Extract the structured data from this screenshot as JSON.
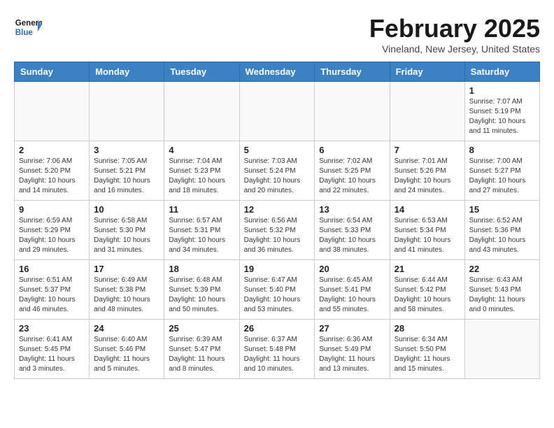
{
  "header": {
    "logo_line1": "General",
    "logo_line2": "Blue",
    "month_title": "February 2025",
    "location": "Vineland, New Jersey, United States"
  },
  "weekdays": [
    "Sunday",
    "Monday",
    "Tuesday",
    "Wednesday",
    "Thursday",
    "Friday",
    "Saturday"
  ],
  "weeks": [
    [
      {
        "day": "",
        "info": ""
      },
      {
        "day": "",
        "info": ""
      },
      {
        "day": "",
        "info": ""
      },
      {
        "day": "",
        "info": ""
      },
      {
        "day": "",
        "info": ""
      },
      {
        "day": "",
        "info": ""
      },
      {
        "day": "1",
        "info": "Sunrise: 7:07 AM\nSunset: 5:19 PM\nDaylight: 10 hours\nand 11 minutes."
      }
    ],
    [
      {
        "day": "2",
        "info": "Sunrise: 7:06 AM\nSunset: 5:20 PM\nDaylight: 10 hours\nand 14 minutes."
      },
      {
        "day": "3",
        "info": "Sunrise: 7:05 AM\nSunset: 5:21 PM\nDaylight: 10 hours\nand 16 minutes."
      },
      {
        "day": "4",
        "info": "Sunrise: 7:04 AM\nSunset: 5:23 PM\nDaylight: 10 hours\nand 18 minutes."
      },
      {
        "day": "5",
        "info": "Sunrise: 7:03 AM\nSunset: 5:24 PM\nDaylight: 10 hours\nand 20 minutes."
      },
      {
        "day": "6",
        "info": "Sunrise: 7:02 AM\nSunset: 5:25 PM\nDaylight: 10 hours\nand 22 minutes."
      },
      {
        "day": "7",
        "info": "Sunrise: 7:01 AM\nSunset: 5:26 PM\nDaylight: 10 hours\nand 24 minutes."
      },
      {
        "day": "8",
        "info": "Sunrise: 7:00 AM\nSunset: 5:27 PM\nDaylight: 10 hours\nand 27 minutes."
      }
    ],
    [
      {
        "day": "9",
        "info": "Sunrise: 6:59 AM\nSunset: 5:29 PM\nDaylight: 10 hours\nand 29 minutes."
      },
      {
        "day": "10",
        "info": "Sunrise: 6:58 AM\nSunset: 5:30 PM\nDaylight: 10 hours\nand 31 minutes."
      },
      {
        "day": "11",
        "info": "Sunrise: 6:57 AM\nSunset: 5:31 PM\nDaylight: 10 hours\nand 34 minutes."
      },
      {
        "day": "12",
        "info": "Sunrise: 6:56 AM\nSunset: 5:32 PM\nDaylight: 10 hours\nand 36 minutes."
      },
      {
        "day": "13",
        "info": "Sunrise: 6:54 AM\nSunset: 5:33 PM\nDaylight: 10 hours\nand 38 minutes."
      },
      {
        "day": "14",
        "info": "Sunrise: 6:53 AM\nSunset: 5:34 PM\nDaylight: 10 hours\nand 41 minutes."
      },
      {
        "day": "15",
        "info": "Sunrise: 6:52 AM\nSunset: 5:36 PM\nDaylight: 10 hours\nand 43 minutes."
      }
    ],
    [
      {
        "day": "16",
        "info": "Sunrise: 6:51 AM\nSunset: 5:37 PM\nDaylight: 10 hours\nand 46 minutes."
      },
      {
        "day": "17",
        "info": "Sunrise: 6:49 AM\nSunset: 5:38 PM\nDaylight: 10 hours\nand 48 minutes."
      },
      {
        "day": "18",
        "info": "Sunrise: 6:48 AM\nSunset: 5:39 PM\nDaylight: 10 hours\nand 50 minutes."
      },
      {
        "day": "19",
        "info": "Sunrise: 6:47 AM\nSunset: 5:40 PM\nDaylight: 10 hours\nand 53 minutes."
      },
      {
        "day": "20",
        "info": "Sunrise: 6:45 AM\nSunset: 5:41 PM\nDaylight: 10 hours\nand 55 minutes."
      },
      {
        "day": "21",
        "info": "Sunrise: 6:44 AM\nSunset: 5:42 PM\nDaylight: 10 hours\nand 58 minutes."
      },
      {
        "day": "22",
        "info": "Sunrise: 6:43 AM\nSunset: 5:43 PM\nDaylight: 11 hours\nand 0 minutes."
      }
    ],
    [
      {
        "day": "23",
        "info": "Sunrise: 6:41 AM\nSunset: 5:45 PM\nDaylight: 11 hours\nand 3 minutes."
      },
      {
        "day": "24",
        "info": "Sunrise: 6:40 AM\nSunset: 5:46 PM\nDaylight: 11 hours\nand 5 minutes."
      },
      {
        "day": "25",
        "info": "Sunrise: 6:39 AM\nSunset: 5:47 PM\nDaylight: 11 hours\nand 8 minutes."
      },
      {
        "day": "26",
        "info": "Sunrise: 6:37 AM\nSunset: 5:48 PM\nDaylight: 11 hours\nand 10 minutes."
      },
      {
        "day": "27",
        "info": "Sunrise: 6:36 AM\nSunset: 5:49 PM\nDaylight: 11 hours\nand 13 minutes."
      },
      {
        "day": "28",
        "info": "Sunrise: 6:34 AM\nSunset: 5:50 PM\nDaylight: 11 hours\nand 15 minutes."
      },
      {
        "day": "",
        "info": ""
      }
    ]
  ]
}
